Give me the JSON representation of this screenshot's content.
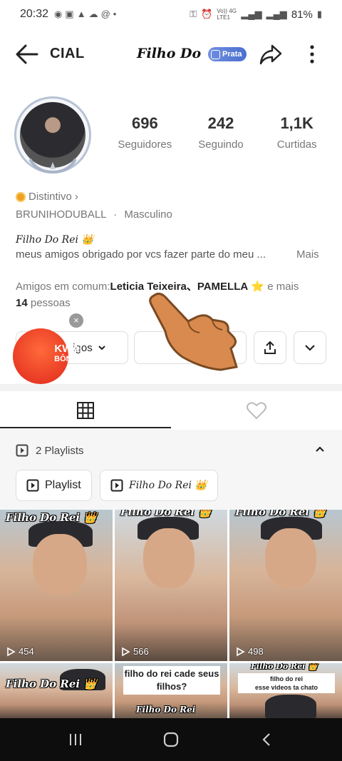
{
  "status_bar": {
    "time": "20:32",
    "network": "Vo)) 4G LTE1",
    "battery": "81%"
  },
  "header": {
    "name": "CIAL",
    "title": "Filho Do",
    "badge": "Prata"
  },
  "stats": [
    {
      "value": "696",
      "label": "Seguidores"
    },
    {
      "value": "242",
      "label": "Seguindo"
    },
    {
      "value": "1,1K",
      "label": "Curtidas"
    }
  ],
  "profile": {
    "badge_label": "Distintivo",
    "badge_chevron": "›",
    "username": "BRUNIHODUBALL",
    "separator": "·",
    "gender": "Masculino",
    "bio_title": "Filho Do Rei 👑",
    "bio_text": "meus amigos obrigado por vcs fazer parte do meu ...",
    "bio_more": "Mais",
    "mutual_prefix": "Amigos em comum:",
    "mutual_names": "Leticia Teixeira、PAMELLA",
    "mutual_star": "⭐",
    "mutual_suffix": " e mais",
    "mutual_count": "14",
    "mutual_people": " pessoas"
  },
  "actions": {
    "friends_label": "igos",
    "kwai_line1": "KWAI",
    "kwai_line2": "BÔNUS",
    "kwai_close": "×"
  },
  "playlists": {
    "header": "2 Playlists",
    "chips": [
      "Playlist",
      "Filho Do Rei 👑"
    ]
  },
  "grid": {
    "label_main": "Filho Do Rei 👑",
    "tiles": [
      {
        "views": "454"
      },
      {
        "views": "566"
      },
      {
        "views": "498"
      }
    ],
    "bottom_text_1": "filho do rei cade seus filhos?",
    "bottom_text_1_sub": "Filho Do Rei",
    "bottom_text_2_title": "Filho Do Rei 👑",
    "bottom_text_2_line1": "filho do rei",
    "bottom_text_2_line2": "esse videos ta chato"
  },
  "colors": {
    "accent_badge": "#5b7fdc",
    "kwai": "#e0271c",
    "nav_bg": "#0d0d0d"
  }
}
